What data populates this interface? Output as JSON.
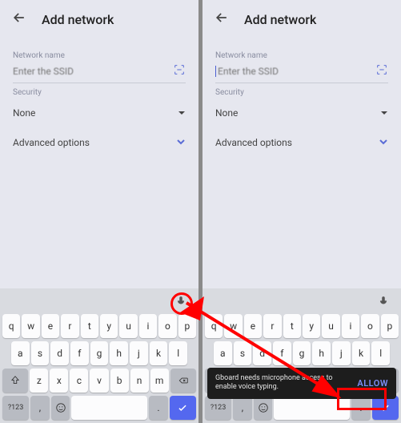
{
  "header": {
    "title": "Add network"
  },
  "network": {
    "name_label": "Network name",
    "ssid_placeholder": "Enter the SSID",
    "security_label": "Security",
    "security_value": "None",
    "advanced_label": "Advanced options"
  },
  "keyboard": {
    "row1": [
      "q",
      "w",
      "e",
      "r",
      "t",
      "y",
      "u",
      "i",
      "o",
      "p"
    ],
    "row2": [
      "a",
      "s",
      "d",
      "f",
      "g",
      "h",
      "j",
      "k",
      "l"
    ],
    "row3": [
      "z",
      "x",
      "c",
      "v",
      "b",
      "n",
      "m"
    ],
    "numkey": "?123",
    "comma": ",",
    "period": "."
  },
  "snackbar": {
    "message": "Gboard needs microphone access to enable voice typing.",
    "action": "ALLOW"
  },
  "icons": {
    "back": "back-arrow",
    "qr": "qr-scan",
    "mic": "microphone",
    "shift": "shift",
    "backspace": "backspace",
    "emoji": "emoji",
    "check": "check"
  }
}
